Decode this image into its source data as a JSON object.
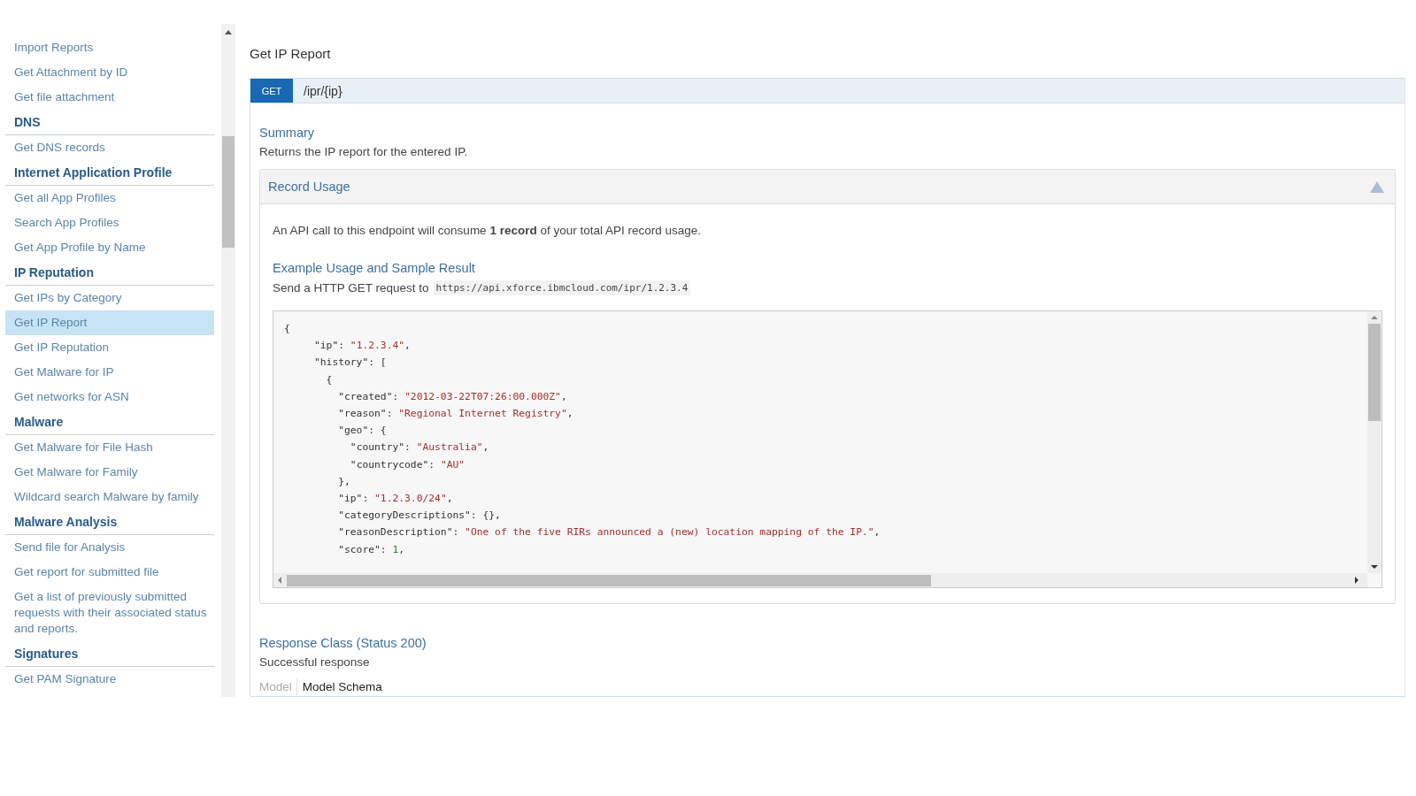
{
  "sidebar": {
    "items": [
      {
        "kind": "link",
        "label": "Import Reports",
        "selected": false
      },
      {
        "kind": "link",
        "label": "Get Attachment by ID",
        "selected": false
      },
      {
        "kind": "link",
        "label": "Get file attachment",
        "selected": false
      },
      {
        "kind": "heading",
        "label": "DNS"
      },
      {
        "kind": "link",
        "label": "Get DNS records",
        "selected": false
      },
      {
        "kind": "heading",
        "label": "Internet Application Profile"
      },
      {
        "kind": "link",
        "label": "Get all App Profiles",
        "selected": false
      },
      {
        "kind": "link",
        "label": "Search App Profiles",
        "selected": false
      },
      {
        "kind": "link",
        "label": "Get App Profile by Name",
        "selected": false
      },
      {
        "kind": "heading",
        "label": "IP Reputation"
      },
      {
        "kind": "link",
        "label": "Get IPs by Category",
        "selected": false
      },
      {
        "kind": "link",
        "label": "Get IP Report",
        "selected": true
      },
      {
        "kind": "link",
        "label": "Get IP Reputation",
        "selected": false
      },
      {
        "kind": "link",
        "label": "Get Malware for IP",
        "selected": false
      },
      {
        "kind": "link",
        "label": "Get networks for ASN",
        "selected": false
      },
      {
        "kind": "heading",
        "label": "Malware"
      },
      {
        "kind": "link",
        "label": "Get Malware for File Hash",
        "selected": false
      },
      {
        "kind": "link",
        "label": "Get Malware for Family",
        "selected": false
      },
      {
        "kind": "link",
        "label": "Wildcard search Malware by family",
        "selected": false
      },
      {
        "kind": "heading",
        "label": "Malware Analysis"
      },
      {
        "kind": "link",
        "label": "Send file for Analysis",
        "selected": false
      },
      {
        "kind": "link",
        "label": "Get report for submitted file",
        "selected": false
      },
      {
        "kind": "link",
        "label": "Get a list of previously submitted requests with their associated status and reports.",
        "selected": false
      },
      {
        "kind": "heading",
        "label": "Signatures"
      },
      {
        "kind": "link",
        "label": "Get PAM Signature",
        "selected": false
      }
    ]
  },
  "page_title": "Get IP Report",
  "endpoint": {
    "method": "GET",
    "path": "/ipr/{ip}"
  },
  "summary": {
    "heading": "Summary",
    "text": "Returns the IP report for the entered IP."
  },
  "record_usage": {
    "title": "Record Usage",
    "expanded": true,
    "text": "An API call to this endpoint will consume **1 record** of your total API record usage.",
    "example_heading": "Example Usage and Sample Result",
    "request_text": "Send a HTTP GET request to",
    "request_url": "https://api.xforce.ibmcloud.com/ipr/1.2.3.4",
    "code_lines": [
      "{",
      "     \"ip\": \"1.2.3.4\",",
      "     \"history\": [",
      "       {",
      "         \"created\": \"2012-03-22T07:26:00.000Z\",",
      "         \"reason\": \"Regional Internet Registry\",",
      "         \"geo\": {",
      "           \"country\": \"Australia\",",
      "           \"countrycode\": \"AU\"",
      "         },",
      "         \"ip\": \"1.2.3.0/24\",",
      "         \"categoryDescriptions\": {},",
      "         \"reasonDescription\": \"One of the five RIRs announced a (new) location mapping of the IP.\",",
      "         \"score\": 1,"
    ]
  },
  "response": {
    "heading": "Response Class (Status 200)",
    "text": "Successful response",
    "tabs": [
      {
        "label": "Model",
        "selected": false
      },
      {
        "label": "Model Schema",
        "selected": true
      }
    ]
  }
}
